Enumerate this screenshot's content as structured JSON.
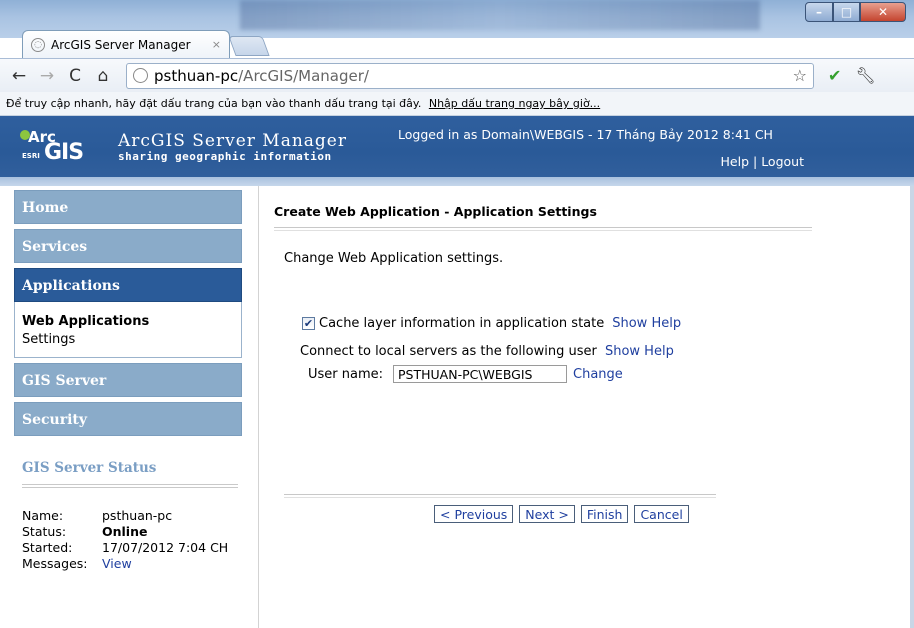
{
  "browser": {
    "tab_title": "ArcGIS Server Manager",
    "tab_close": "×",
    "url_host": "psthuan-pc",
    "url_path": "/ArcGIS/Manager/",
    "bookmark_hint": "Để truy cập nhanh, hãy đặt dấu trang của bạn vào thanh dấu trang tại đây.",
    "bookmark_link": "Nhập dấu trang ngay bây giờ..."
  },
  "header": {
    "logo_top": "Arc",
    "logo_bottom": "GIS",
    "logo_esri": "ESRI",
    "app_name": "ArcGIS Server Manager",
    "app_tagline": "sharing geographic information",
    "login_text": "Logged in as Domain\\WEBGIS - 17 Tháng Bảy 2012 8:41 CH",
    "help": "Help",
    "separator": "|",
    "logout": "Logout"
  },
  "sidebar": {
    "home": "Home",
    "services": "Services",
    "applications": "Applications",
    "web_applications": "Web Applications",
    "settings": "Settings",
    "gis_server": "GIS Server",
    "security": "Security"
  },
  "status": {
    "title": "GIS Server Status",
    "name_label": "Name:",
    "name_value": "psthuan-pc",
    "status_label": "Status:",
    "status_value": "Online",
    "started_label": "Started:",
    "started_value": "17/07/2012 7:04 CH",
    "messages_label": "Messages:",
    "messages_value": "View"
  },
  "main": {
    "title": "Create Web Application - Application Settings",
    "description": "Change Web Application settings.",
    "cache_label": "Cache layer information in application state",
    "cache_checked": true,
    "show_help": "Show Help",
    "connect_label": "Connect to local servers as the following user",
    "user_name_label": "User name:",
    "user_name_value": "PSTHUAN-PC\\WEBGIS",
    "change": "Change"
  },
  "buttons": {
    "previous": "< Previous",
    "next": "Next >",
    "finish": "Finish",
    "cancel": "Cancel"
  }
}
